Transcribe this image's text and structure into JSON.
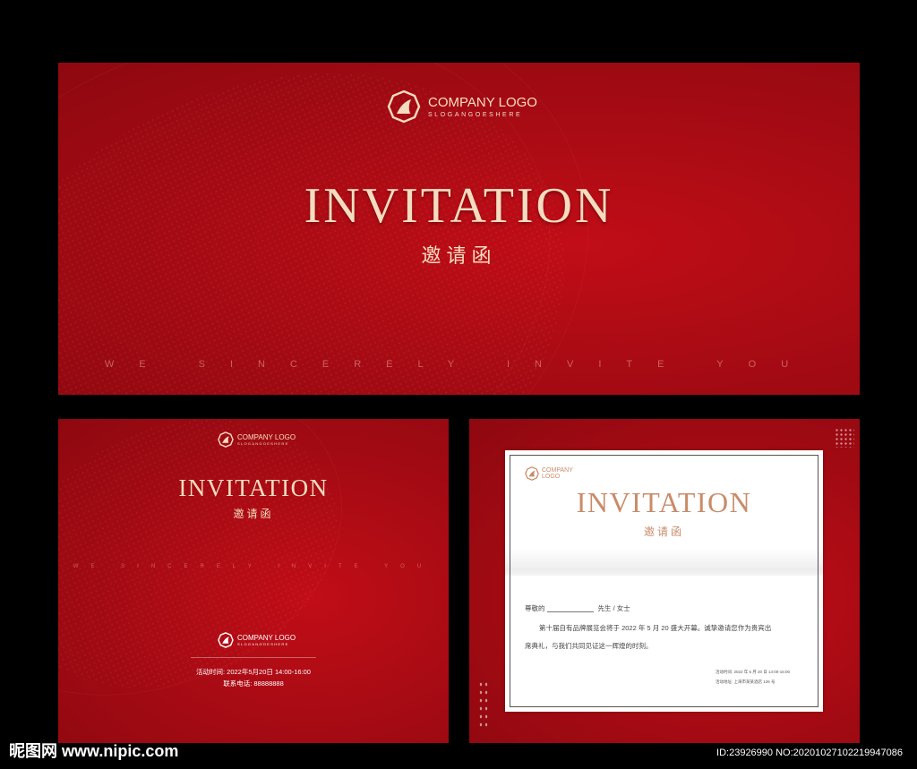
{
  "top_card": {
    "logo_name": "COMPANY LOGO",
    "logo_slogan": "SLOGANGOESHERE",
    "title": "INVITATION",
    "subtitle_cn": "邀请函",
    "tagline": "WE SINCERELY INVITE YOU"
  },
  "bottom_left_card": {
    "logo_name": "COMPANY LOGO",
    "logo_slogan": "SLOGANGOESHERE",
    "title": "INVITATION",
    "subtitle_cn": "邀请函",
    "tagline": "WE SINCERELY INVITE YOU",
    "back_logo_name": "COMPANY LOGO",
    "back_logo_slogan": "SLOGANGOESHERE",
    "event_time": "活动时间: 2022年5月20日 14:00-16:00",
    "contact": "联系电话: 88888888"
  },
  "bottom_right_card": {
    "logo_name": "COMPANY",
    "logo_name2": "LOGO",
    "title": "INVITATION",
    "subtitle_cn": "邀请函",
    "salutation": "尊敬的",
    "salutation_suffix": "先生 / 女士",
    "body_line1": "第十届自有品牌展览会将于 2022 年 5 月 20 盛大开幕。诚挚邀请您作为贵宾出",
    "body_line2": "席典礼，与我们共同见证这一辉煌的时刻。",
    "footer_time": "活动时间: 2022 年 5 月 20 日 14:00-16:00",
    "footer_address": "活动地址: 上海市某某酒店 126 号"
  },
  "watermark": {
    "left": "昵图网 www.nipic.com",
    "right": "ID:23926990 NO:20201027102219947086"
  },
  "colors": {
    "background": "#000000",
    "card_red": "#a90b14",
    "gold": "#f3dcc0",
    "rose_gold": "#c88c6a"
  }
}
